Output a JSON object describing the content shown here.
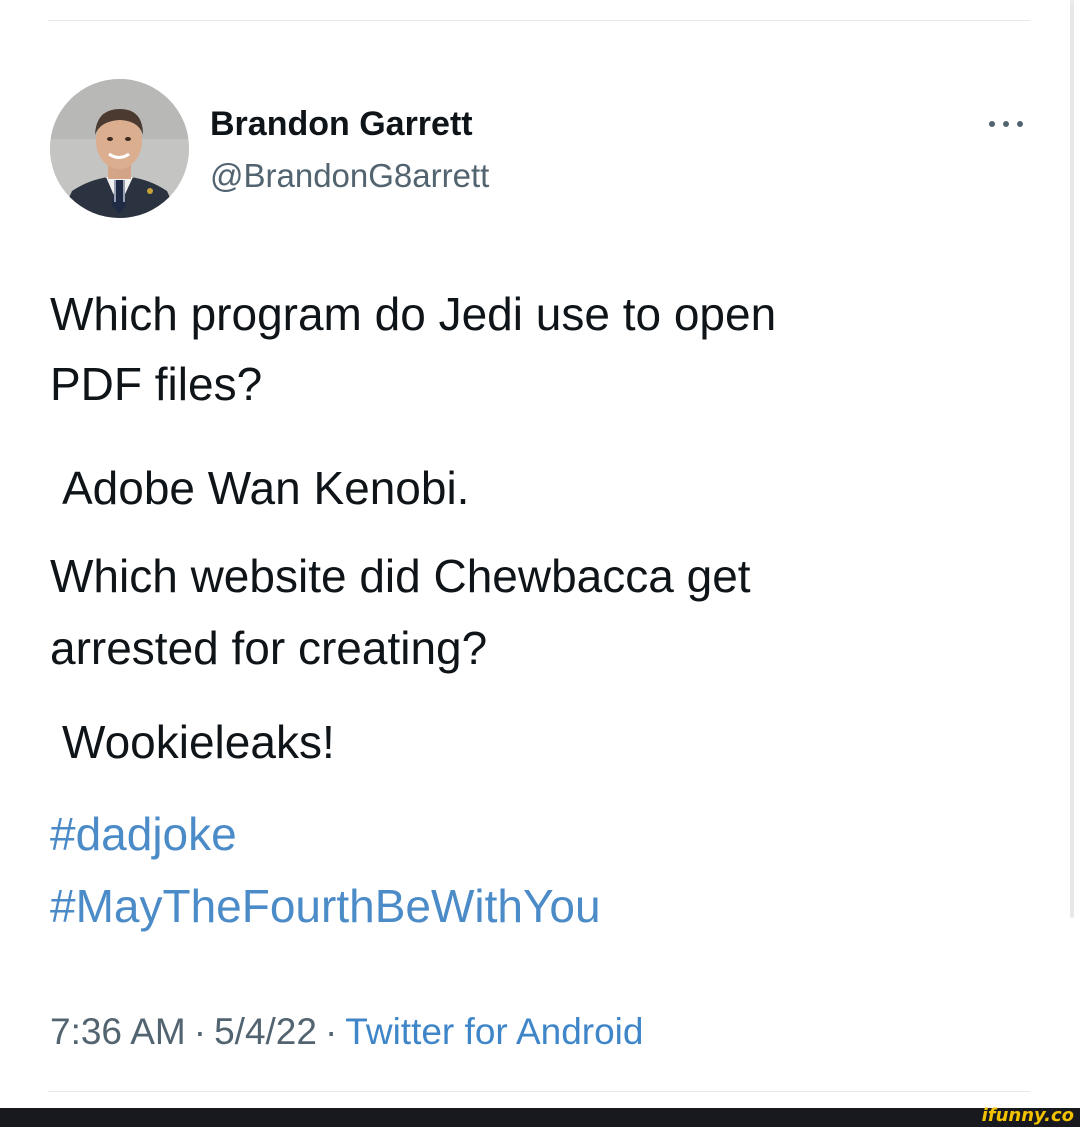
{
  "tweet": {
    "author": {
      "name": "Brandon Garrett",
      "handle": "@BrandonG8arrett"
    },
    "text_lines": [
      "Which program do Jedi use to open",
      "PDF files?",
      "Adobe Wan Kenobi.",
      "Which website did Chewbacca get",
      "arrested for creating?",
      "Wookieleaks!"
    ],
    "hashtags": [
      "#dadjoke",
      "#MayTheFourthBeWithYou"
    ],
    "meta": {
      "time": "7:36 AM",
      "separator": "·",
      "date": "5/4/22",
      "source": "Twitter for Android"
    }
  },
  "icons": {
    "more": "more-horizontal-icon",
    "avatar": "profile-photo"
  },
  "colors": {
    "text": "#0f1419",
    "secondary": "#536471",
    "link": "#4b8bc8",
    "watermark": "#f2c200",
    "footer": "#17191e"
  },
  "watermark": {
    "text": "ifunny.co"
  }
}
